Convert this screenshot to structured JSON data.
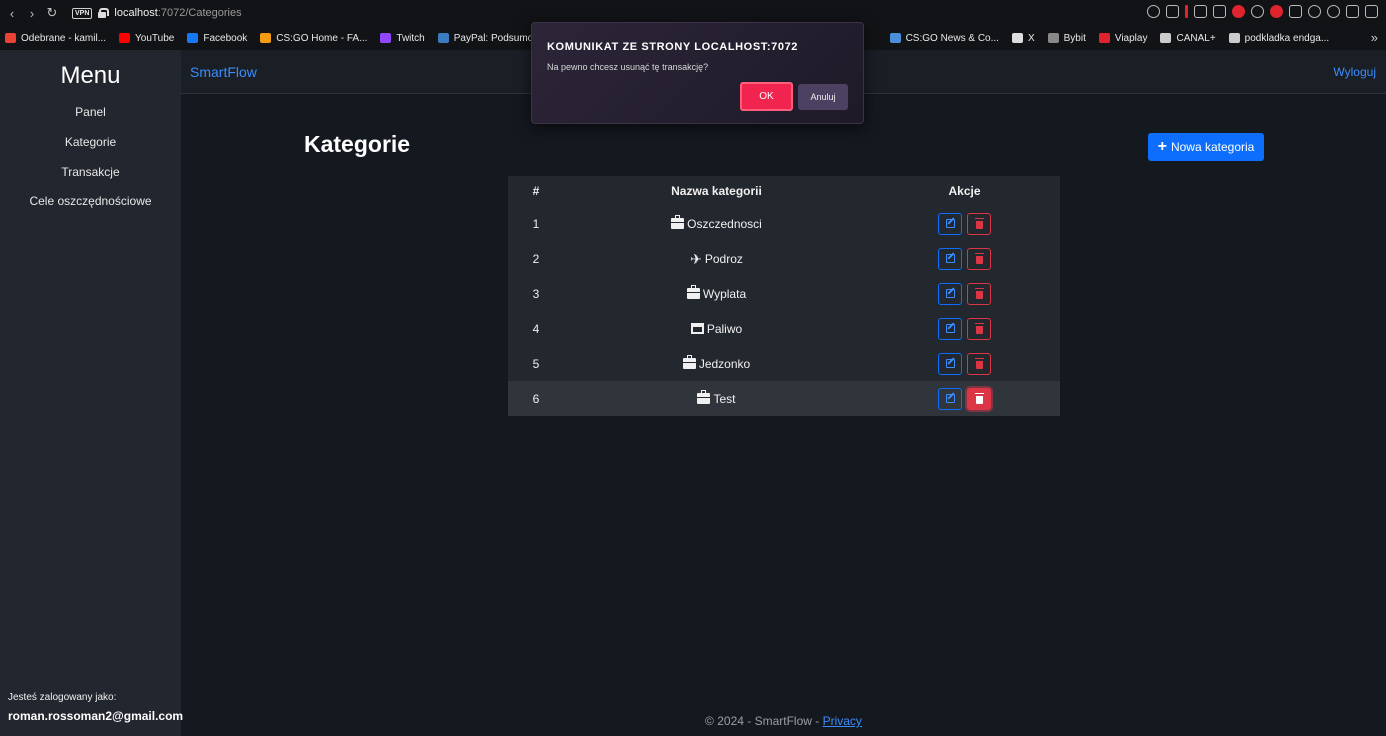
{
  "browser": {
    "url_host": "localhost",
    "url_path": ":7072/Categories",
    "vpn_label": "VPN",
    "bookmarks": [
      {
        "label": "Odebrane - kamil...",
        "color": "#ea4335"
      },
      {
        "label": "YouTube",
        "color": "#ff0000"
      },
      {
        "label": "Facebook",
        "color": "#1877f2"
      },
      {
        "label": "CS:GO Home - FA...",
        "color": "#f39c12"
      },
      {
        "label": "Twitch",
        "color": "#9146ff"
      },
      {
        "label": "PayPal: Podsumo...",
        "color": "#3b7bbf"
      },
      {
        "label": "CS:GO News & Co...",
        "color": "#4a90d9"
      },
      {
        "label": "X",
        "color": "#dddddd"
      },
      {
        "label": "Bybit",
        "color": "#888888"
      },
      {
        "label": "Viaplay",
        "color": "#e0242e"
      },
      {
        "label": "CANAL+",
        "color": "#cccccc"
      },
      {
        "label": "podkladka endga...",
        "color": "#cccccc"
      }
    ]
  },
  "sidebar": {
    "title": "Menu",
    "links": [
      "Panel",
      "Kategorie",
      "Transakcje",
      "Cele oszczędnościowe"
    ],
    "logged_label": "Jesteś zalogowany jako:",
    "logged_email": "roman.rossoman2@gmail.com"
  },
  "topbar": {
    "brand": "SmartFlow",
    "logout": "Wyloguj"
  },
  "main": {
    "title": "Kategorie",
    "new_button": "Nowa kategoria",
    "table": {
      "headers": [
        "#",
        "Nazwa kategorii",
        "Akcje"
      ],
      "rows": [
        {
          "num": "1",
          "name": "Oszczednosci",
          "icon": "briefcase-icon"
        },
        {
          "num": "2",
          "name": "Podroz",
          "icon": "plane-icon"
        },
        {
          "num": "3",
          "name": "Wyplata",
          "icon": "briefcase-icon"
        },
        {
          "num": "4",
          "name": "Paliwo",
          "icon": "store-icon"
        },
        {
          "num": "5",
          "name": "Jedzonko",
          "icon": "briefcase-icon"
        },
        {
          "num": "6",
          "name": "Test",
          "icon": "briefcase-icon"
        }
      ]
    }
  },
  "footer": {
    "text": "© 2024 - SmartFlow - ",
    "privacy": "Privacy"
  },
  "dialog": {
    "title": "KOMUNIKAT ZE STRONY LOCALHOST:7072",
    "message": "Na pewno chcesz usunąć tę transakcję?",
    "ok": "OK",
    "cancel": "Anuluj"
  },
  "colors": {
    "accent": "#0d6efd",
    "danger": "#dc3545",
    "dialog_ok": "#f0244e"
  }
}
